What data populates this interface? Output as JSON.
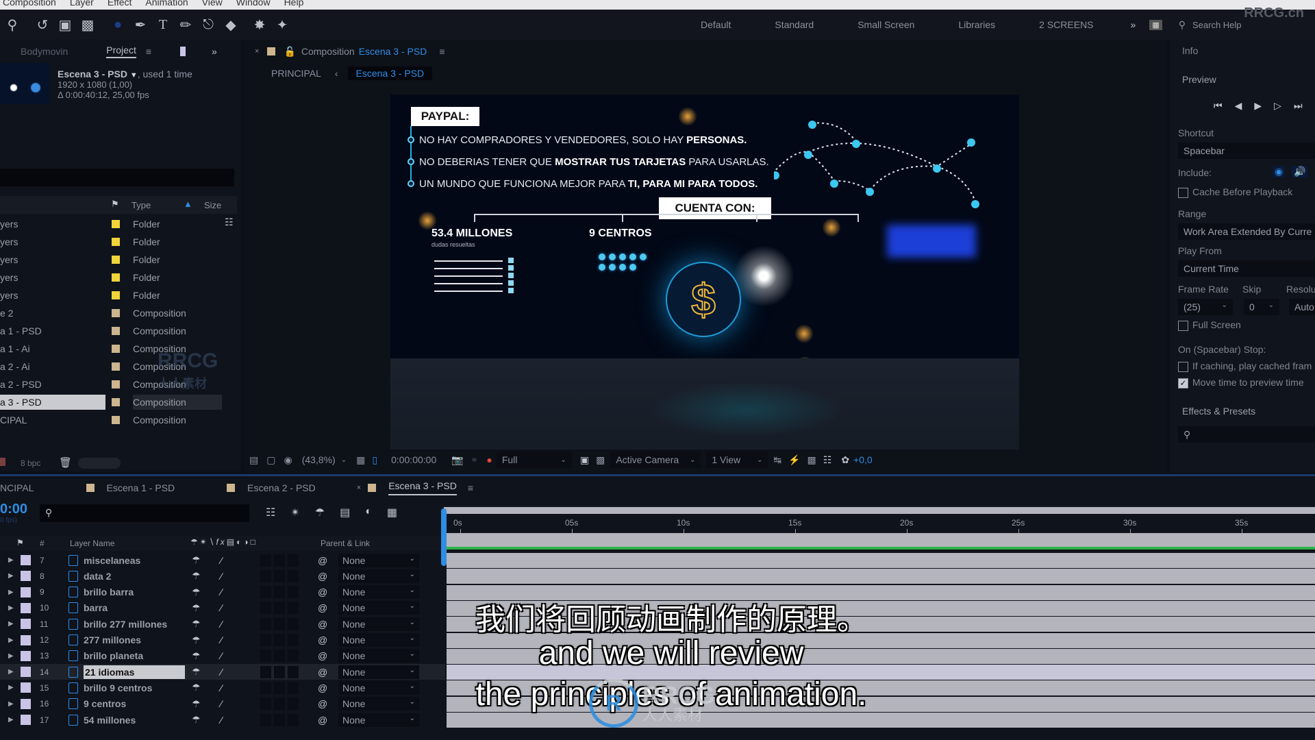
{
  "menu": [
    "Composition",
    "Layer",
    "Effect",
    "Animation",
    "View",
    "Window",
    "Help"
  ],
  "workspaces": [
    "Default",
    "Standard",
    "Small Screen",
    "Libraries",
    "2 SCREENS"
  ],
  "search_help": "Search Help",
  "watermark_corner": "RRCG.cn",
  "project_panel": {
    "tabs": [
      "Bodymovin",
      "Project"
    ],
    "selected_item": {
      "name": "Escena 3 - PSD",
      "usage": ", used 1 time",
      "dims": "1920 x 1080 (1,00)",
      "duration": "Δ 0:00:40:12, 25,00 fps"
    },
    "search_placeholder": "",
    "columns": {
      "type": "Type",
      "size": "Size"
    },
    "items": [
      {
        "name": "yers",
        "type": "Folder",
        "kind": "folder"
      },
      {
        "name": "yers",
        "type": "Folder",
        "kind": "folder"
      },
      {
        "name": "yers",
        "type": "Folder",
        "kind": "folder"
      },
      {
        "name": "yers",
        "type": "Folder",
        "kind": "folder"
      },
      {
        "name": "yers",
        "type": "Folder",
        "kind": "folder"
      },
      {
        "name": "e 2",
        "type": "Composition",
        "kind": "comp"
      },
      {
        "name": "a 1 - PSD",
        "type": "Composition",
        "kind": "comp"
      },
      {
        "name": "a 1 - Ai",
        "type": "Composition",
        "kind": "comp"
      },
      {
        "name": "a 2 - Ai",
        "type": "Composition",
        "kind": "comp"
      },
      {
        "name": "a 2 - PSD",
        "type": "Composition",
        "kind": "comp"
      },
      {
        "name": "a 3 - PSD",
        "type": "Composition",
        "kind": "comp",
        "selected": true
      },
      {
        "name": "CIPAL",
        "type": "Composition",
        "kind": "comp"
      }
    ],
    "bpc": "8 bpc"
  },
  "composition_panel": {
    "tab_prefix": "Composition",
    "tab_name": "Escena 3 - PSD",
    "breadcrumb": [
      "PRINCIPAL",
      "Escena 3 - PSD"
    ],
    "canvas": {
      "title": "PAYPAL:",
      "bullets": [
        {
          "text": "NO HAY COMPRADORES Y VENDEDORES, SOLO HAY ",
          "bold": "PERSONAS.",
          "after": ""
        },
        {
          "text": "NO DEBERIAS TENER QUE ",
          "bold": "MOSTRAR TUS TARJETAS",
          "after": " PARA USARLAS."
        },
        {
          "text": "UN MUNDO QUE FUNCIONA MEJOR PARA ",
          "bold": "TI, PARA MI PARA TODOS.",
          "after": ""
        }
      ],
      "cuenta": "CUENTA CON:",
      "stat1_title": "53.4 MILLONES",
      "stat1_sub": "dudas resueltas",
      "stat2_title": "9 CENTROS",
      "dollar": "$"
    },
    "controls": {
      "zoom": "(43,8%)",
      "timecode": "0:00:00:00",
      "resolution": "Full",
      "camera": "Active Camera",
      "view": "1 View",
      "exposure": "+0,0"
    }
  },
  "right_panel": {
    "info": "Info",
    "preview": "Preview",
    "shortcut_label": "Shortcut",
    "shortcut_value": "Spacebar",
    "include_label": "Include:",
    "cache_before": "Cache Before Playback",
    "range_label": "Range",
    "range_value": "Work Area Extended By Curre",
    "play_from_label": "Play From",
    "play_from_value": "Current Time",
    "frame_rate_label": "Frame Rate",
    "skip_label": "Skip",
    "resolution_label": "Resolu",
    "frame_rate_value": "(25)",
    "skip_value": "0",
    "resolution_value": "Auto",
    "full_screen": "Full Screen",
    "stop_label": "On (Spacebar) Stop:",
    "if_caching": "If caching, play cached fram",
    "move_time": "Move time to preview time",
    "move_time_checked": true,
    "effects": "Effects & Presets"
  },
  "timeline": {
    "tabs": [
      "NCIPAL",
      "Escena 1  - PSD",
      "Escena 2 - PSD",
      "Escena 3 - PSD"
    ],
    "timecode": "0:00",
    "fps": "0 fps)",
    "col_layer_name": "Layer Name",
    "col_parent": "Parent & Link",
    "col_num": "#",
    "ruler": [
      "0s",
      "05s",
      "10s",
      "15s",
      "20s",
      "25s",
      "30s",
      "35s"
    ],
    "layers": [
      {
        "num": "7",
        "name": "miscelaneas",
        "parent": "None"
      },
      {
        "num": "8",
        "name": "data 2",
        "parent": "None"
      },
      {
        "num": "9",
        "name": "brillo barra",
        "parent": "None"
      },
      {
        "num": "10",
        "name": "barra",
        "parent": "None"
      },
      {
        "num": "11",
        "name": "brillo 277 millones",
        "parent": "None"
      },
      {
        "num": "12",
        "name": "277 millones",
        "parent": "None"
      },
      {
        "num": "13",
        "name": "brillo planeta",
        "parent": "None"
      },
      {
        "num": "14",
        "name": "21 idiomas",
        "parent": "None",
        "selected": true
      },
      {
        "num": "15",
        "name": "brillo 9 centros",
        "parent": "None"
      },
      {
        "num": "16",
        "name": "9 centros",
        "parent": "None"
      },
      {
        "num": "17",
        "name": "54 millones",
        "parent": "None"
      }
    ]
  },
  "subtitles": {
    "zh": "我们将回顾动画制作的原理。",
    "en1": "and we will review",
    "en2": "the principles of animation."
  },
  "watermark": {
    "brand": "RRCG",
    "cn": "人人素材"
  },
  "colors": {
    "accent": "#2f8de4",
    "folder": "#f0d43a",
    "comp": "#ccb58f",
    "track": "#b4b4bc",
    "workarea": "#2fb34a"
  }
}
